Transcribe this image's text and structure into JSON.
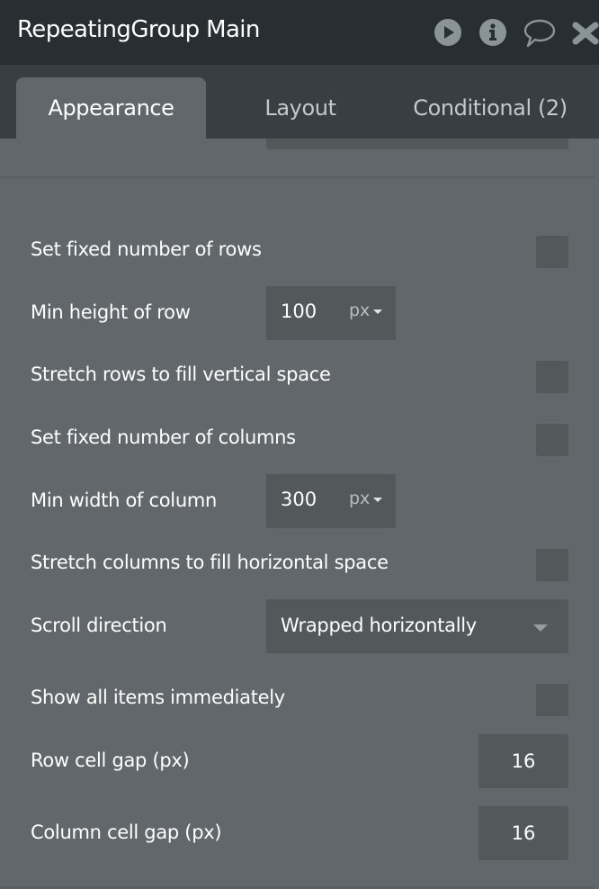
{
  "header": {
    "title": "RepeatingGroup Main",
    "icons": [
      "play-icon",
      "info-icon",
      "comment-icon",
      "close-icon"
    ],
    "icon_color": "#8a9497"
  },
  "tabs": [
    {
      "label": "Appearance",
      "active": true
    },
    {
      "label": "Layout",
      "active": false
    },
    {
      "label": "Conditional (2)",
      "active": false
    }
  ],
  "fields": {
    "fixed_rows": {
      "label": "Set fixed number of rows",
      "checked": false
    },
    "min_row_height": {
      "label": "Min height of row",
      "value": "100",
      "unit": "px"
    },
    "stretch_rows": {
      "label": "Stretch rows to fill vertical space",
      "checked": false
    },
    "fixed_columns": {
      "label": "Set fixed number of columns",
      "checked": false
    },
    "min_col_width": {
      "label": "Min width of column",
      "value": "300",
      "unit": "px"
    },
    "stretch_columns": {
      "label": "Stretch columns to fill horizontal space",
      "checked": false
    },
    "scroll_direction": {
      "label": "Scroll direction",
      "value": "Wrapped horizontally"
    },
    "show_all_items": {
      "label": "Show all items immediately",
      "checked": false
    },
    "row_gap": {
      "label": "Row cell gap (px)",
      "value": "16"
    },
    "column_gap": {
      "label": "Column cell gap (px)",
      "value": "16"
    }
  },
  "colors": {
    "header_bg": "#282e31",
    "tabbar_bg": "#383e42",
    "panel_bg": "#61676b",
    "input_bg": "#53585b"
  }
}
